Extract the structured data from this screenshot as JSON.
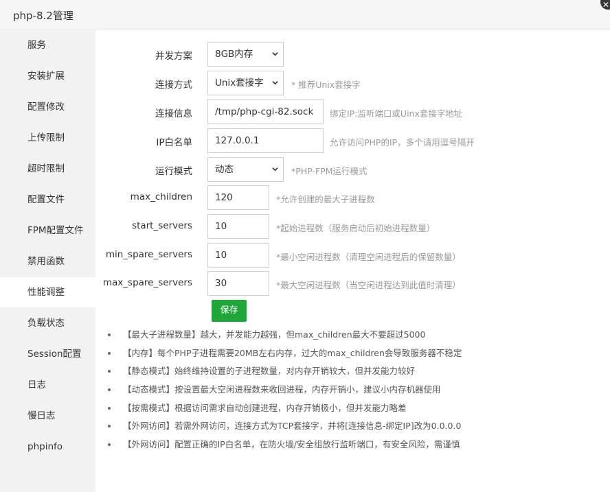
{
  "window": {
    "title": "php-8.2管理",
    "close_glyph": "✕"
  },
  "sidebar": {
    "items": [
      {
        "label": "服务"
      },
      {
        "label": "安装扩展"
      },
      {
        "label": "配置修改"
      },
      {
        "label": "上传限制"
      },
      {
        "label": "超时限制"
      },
      {
        "label": "配置文件"
      },
      {
        "label": "FPM配置文件"
      },
      {
        "label": "禁用函数"
      },
      {
        "label": "性能调整",
        "active": true
      },
      {
        "label": "负载状态"
      },
      {
        "label": "Session配置"
      },
      {
        "label": "日志"
      },
      {
        "label": "慢日志"
      },
      {
        "label": "phpinfo"
      }
    ]
  },
  "form": {
    "concurrency": {
      "label": "并发方案",
      "value": "8GB内存"
    },
    "connection_method": {
      "label": "连接方式",
      "value": "Unix套接字",
      "hint": "* 推荐Unix套接字"
    },
    "connection_info": {
      "label": "连接信息",
      "value": "/tmp/php-cgi-82.sock",
      "hint": "绑定IP:监听端口或Uinx套接字地址"
    },
    "ip_whitelist": {
      "label": "IP白名单",
      "value": "127.0.0.1",
      "hint": "允许访问PHP的IP，多个请用逗号隔开"
    },
    "run_mode": {
      "label": "运行模式",
      "value": "动态",
      "hint": "*PHP-FPM运行模式"
    },
    "max_children": {
      "label": "max_children",
      "value": "120",
      "hint": "*允许创建的最大子进程数"
    },
    "start_servers": {
      "label": "start_servers",
      "value": "10",
      "hint": "*起始进程数（服务启动后初始进程数量）"
    },
    "min_spare_servers": {
      "label": "min_spare_servers",
      "value": "10",
      "hint": "*最小空闲进程数（清理空闲进程后的保留数量）"
    },
    "max_spare_servers": {
      "label": "max_spare_servers",
      "value": "30",
      "hint": "*最大空闲进程数（当空闲进程达到此值时清理）"
    },
    "save_label": "保存"
  },
  "notes": [
    "【最大子进程数量】越大，并发能力越强，但max_children最大不要超过5000",
    "【内存】每个PHP子进程需要20MB左右内存，过大的max_children会导致服务器不稳定",
    "【静态模式】始终维持设置的子进程数量，对内存开销较大，但并发能力较好",
    "【动态模式】按设置最大空闲进程数来收回进程，内存开销小，建议小内存机器使用",
    "【按需模式】根据访问需求自动创建进程，内存开销极小，但并发能力略差",
    "【外网访问】若需外网访问，连接方式为TCP套接字，并将[连接信息-绑定IP]改为0.0.0.0",
    "【外网访问】配置正确的IP白名单，在防火墙/安全组放行监听端口，有安全风险，需谨慎"
  ],
  "colors": {
    "accent": "#20a53a",
    "sidebar_bg": "#f2f2f2",
    "hint": "#999999"
  }
}
